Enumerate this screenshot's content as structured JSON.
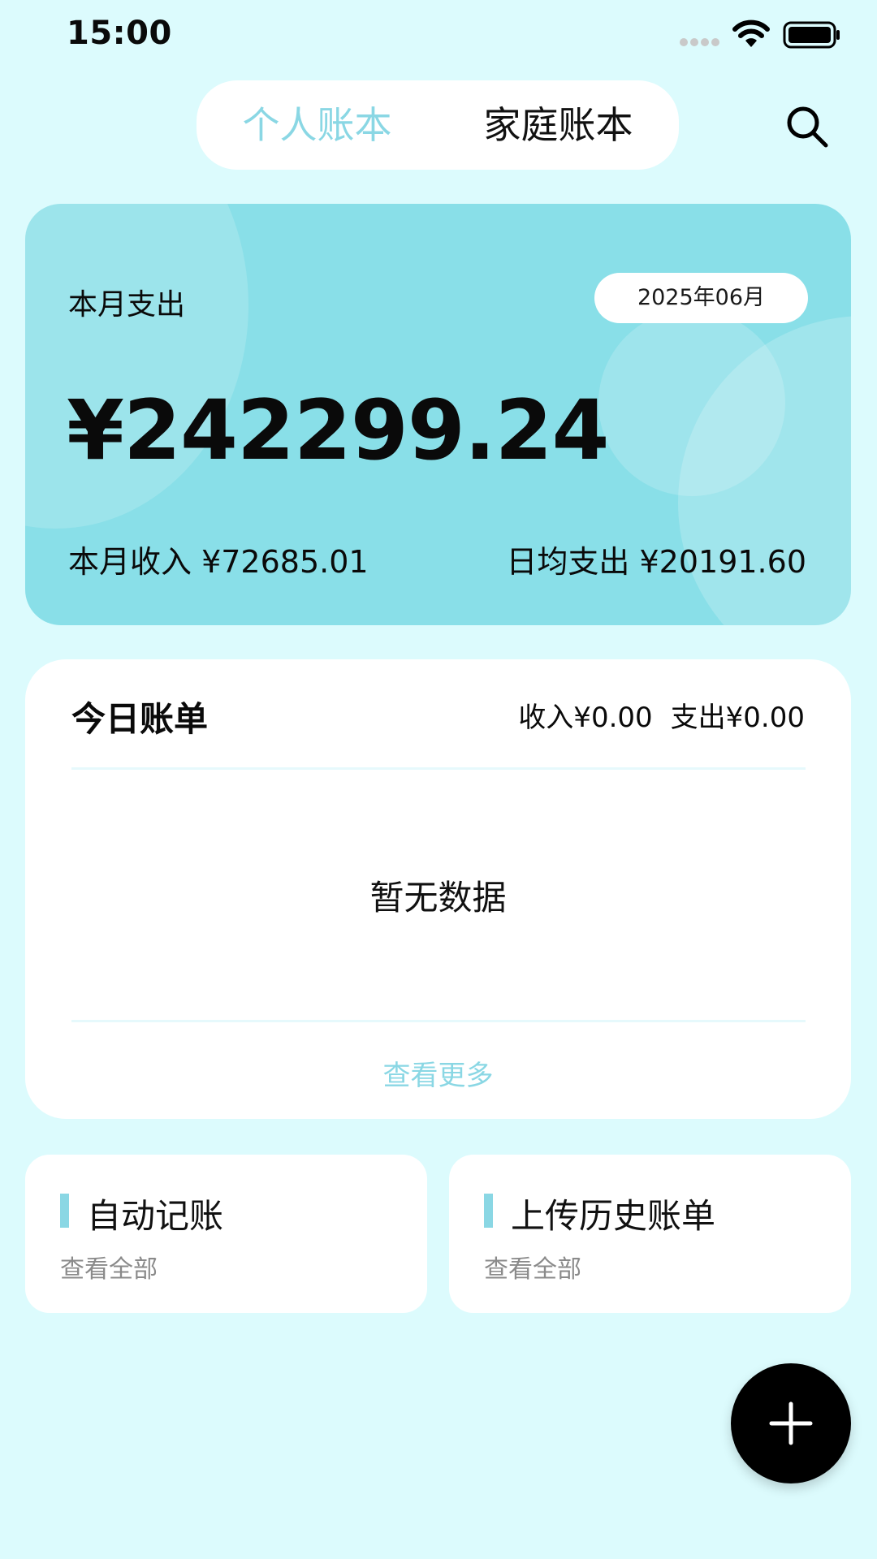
{
  "status_bar": {
    "time": "15:00"
  },
  "header": {
    "tabs": [
      {
        "label": "个人账本",
        "active": true
      },
      {
        "label": "家庭账本",
        "active": false
      }
    ]
  },
  "summary": {
    "expense_label": "本月支出",
    "month": "2025年06月",
    "expense_amount": "¥242299.24",
    "income_text": "本月收入 ¥72685.01",
    "daily_avg_text": "日均支出 ¥20191.60"
  },
  "today": {
    "title": "今日账单",
    "income": "收入¥0.00",
    "expense": "支出¥0.00",
    "empty": "暂无数据",
    "see_more": "查看更多"
  },
  "features": [
    {
      "title": "自动记账",
      "sub": "查看全部"
    },
    {
      "title": "上传历史账单",
      "sub": "查看全部"
    }
  ],
  "colors": {
    "background": "#dcfbfd",
    "accent": "#8ad7e4",
    "card": "#89dfe8"
  }
}
